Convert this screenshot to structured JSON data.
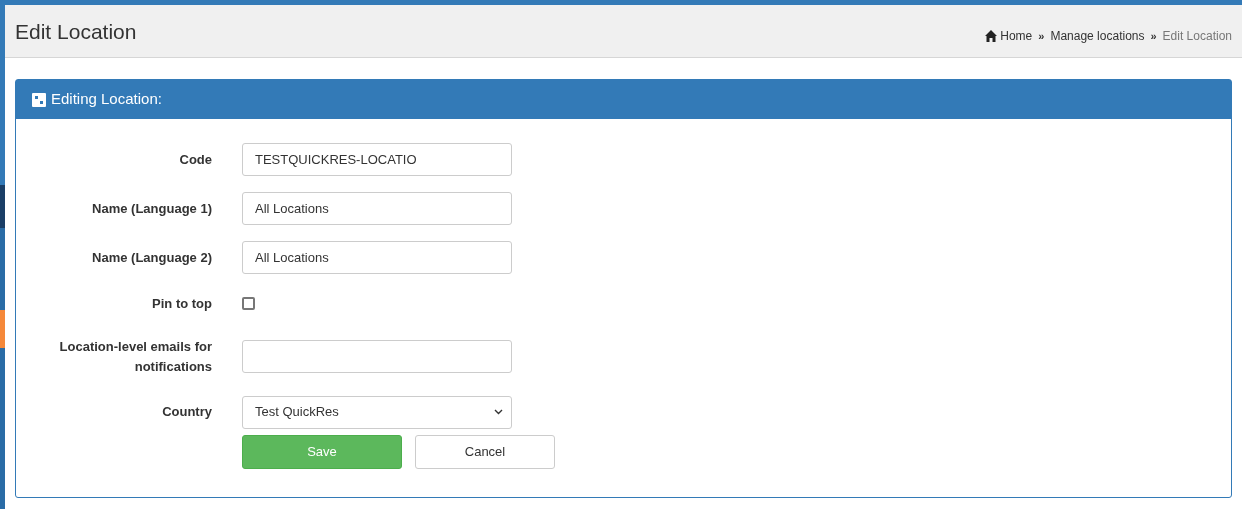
{
  "page_title": "Edit Location",
  "breadcrumb": [
    {
      "label": "Home",
      "kind": "home"
    },
    {
      "label": "Manage locations",
      "kind": "link"
    },
    {
      "label": "Edit Location",
      "kind": "current"
    }
  ],
  "breadcrumb_separator": "»",
  "panel": {
    "title": "Editing Location:"
  },
  "fields": [
    {
      "label": "Code",
      "kind": "text",
      "value": "TESTQUICKRES-LOCATIO"
    },
    {
      "label": "Name (Language 1)",
      "kind": "text",
      "value": "All Locations"
    },
    {
      "label": "Name (Language 2)",
      "kind": "text",
      "value": "All Locations"
    },
    {
      "label": "Pin to top",
      "kind": "checkbox",
      "checked": false
    },
    {
      "label": "Location-level emails for notifications",
      "kind": "text"
    },
    {
      "label": "Country",
      "kind": "select",
      "value": "Test QuickRes"
    }
  ],
  "buttons": [
    {
      "label": "Save",
      "kind": "primary"
    },
    {
      "label": "Cancel",
      "kind": "default"
    }
  ]
}
